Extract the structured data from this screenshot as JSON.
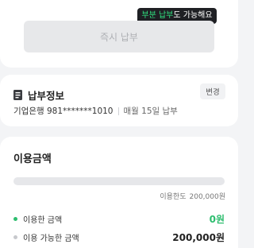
{
  "tooltip": {
    "highlight": "부분 납부",
    "rest": "도 가능해요"
  },
  "pay_button": {
    "label": "즉시 납부"
  },
  "payment_info": {
    "title": "납부정보",
    "change_label": "변경",
    "bank_account": "기업은행 981*******1010",
    "due_date": "매월 15일 납부"
  },
  "usage": {
    "title": "이용금액",
    "limit_label": "이용한도",
    "limit_value": "200,000원",
    "used_fraction": 0,
    "used_label": "이용한 금액",
    "used_amount": "0원",
    "available_label": "이용 가능한 금액",
    "available_amount": "200,000원"
  },
  "colors": {
    "accent": "#2dbd6e",
    "tooltip_bg": "#1f2024",
    "tooltip_highlight": "#2fe07f"
  },
  "icons": {
    "payment_info": "document-icon"
  }
}
